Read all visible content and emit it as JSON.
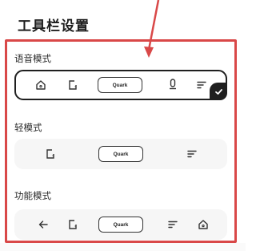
{
  "header": {
    "title": "工具栏设置"
  },
  "sections": [
    {
      "label": "语音模式",
      "selected": true,
      "tools": [
        {
          "icon": "home-icon"
        },
        {
          "icon": "tabs-icon"
        },
        {
          "icon": "quark-button",
          "label": "Quark"
        },
        {
          "icon": "microphone-icon"
        },
        {
          "icon": "menu-icon"
        }
      ]
    },
    {
      "label": "轻模式",
      "selected": false,
      "tools": [
        {
          "icon": "tabs-icon"
        },
        {
          "icon": "quark-button",
          "label": "Quark"
        },
        {
          "icon": "menu-icon"
        }
      ]
    },
    {
      "label": "功能模式",
      "selected": false,
      "tools": [
        {
          "icon": "back-arrow-icon"
        },
        {
          "icon": "tabs-icon"
        },
        {
          "icon": "quark-button",
          "label": "Quark"
        },
        {
          "icon": "menu-icon"
        },
        {
          "icon": "home-icon"
        }
      ]
    }
  ],
  "colors": {
    "highlight": "#d94848",
    "selected_border": "#1f1f1f",
    "toolbar_bg": "#f6f6f6"
  }
}
